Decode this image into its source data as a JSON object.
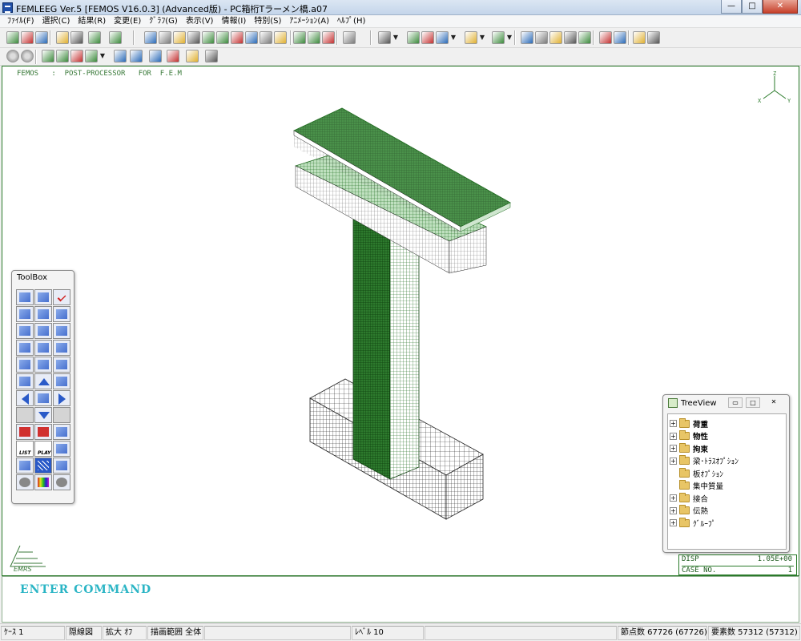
{
  "window": {
    "title": "FEMLEEG Ver.5 [FEMOS V16.0.3] (Advanced版) - PC箱桁Tラーメン橋.a07",
    "controls": {
      "minimize": "—",
      "maximize": "□",
      "close": "✕"
    }
  },
  "menubar": {
    "items": [
      {
        "label": "ﾌｧｲﾙ(F)"
      },
      {
        "label": "選択(C)"
      },
      {
        "label": "結果(R)"
      },
      {
        "label": "変更(E)"
      },
      {
        "label": "ｸﾞﾗﾌ(G)"
      },
      {
        "label": "表示(V)"
      },
      {
        "label": "情報(I)"
      },
      {
        "label": "特別(S)"
      },
      {
        "label": "ｱﾆﾒｰｼｮﾝ(A)"
      },
      {
        "label": "ﾍﾙﾌﾟ(H)"
      }
    ]
  },
  "toolbar1_icons": [
    "open-icon",
    "copy-icon",
    "mesh-icon",
    "layers-icon",
    "stack-icon",
    "print-icon",
    "export-icon",
    "contour-icon",
    "color-icon",
    "grid-green-icon",
    "grid-icon",
    "deform-icon",
    "vector-icon",
    "stress-icon",
    "node-icon",
    "circle-icon",
    "line-icon",
    "graph1-icon",
    "graph2-icon",
    "graph3-icon",
    "spring-icon",
    "view-icon",
    "rotate-icon",
    "pan-icon",
    "zoom-icon",
    "zoom2-icon",
    "red-mesh-icon",
    "red-node-icon",
    "grid-red-icon",
    "grid-dark-icon",
    "grid-black-icon",
    "section-icon",
    "down-arrow-icon",
    "up-arrow-icon"
  ],
  "toolbar2_icons": [
    "undo-icon",
    "redo-icon",
    "select-icon",
    "load-icon",
    "bc-icon",
    "material-icon",
    "sphere-icon",
    "cut-icon",
    "axis-icon",
    "label-icon",
    "ruler-icon",
    "legend-icon"
  ],
  "canvas": {
    "header": "FEMOS   :  POST-PROCESSOR   FOR  F.E.M",
    "axis": {
      "z": "Z",
      "x": "X",
      "y": "Y"
    }
  },
  "legend": {
    "row1_label": "DISP",
    "row1_value": "1.05E+00",
    "row2_label": "CASE NO.",
    "row2_value": "1"
  },
  "command": {
    "prompt": "ENTER COMMAND"
  },
  "status": {
    "case": "ｹｰｽ 1",
    "view": "隠線図",
    "zoom": "拡大 ｵﾌ",
    "range": "描画範囲 全体",
    "blank1": "",
    "level": "ﾚﾍﾞﾙ 10",
    "blank2": "",
    "nodes": "節点数 67726 (67726)",
    "elements": "要素数 57312 (57312)"
  },
  "toolbox": {
    "title": "ToolBox",
    "buttons": [
      "flip-view-icon",
      "multi-select-icon",
      "check-icon",
      "cube-front-icon",
      "cube-side-icon",
      "cube-top-icon",
      "cube-iso-icon",
      "cube-rotate-icon",
      "cube-yellow-icon",
      "axis-yx-icon",
      "axis-zx-icon",
      "axis-zy-icon",
      "rotate-x-icon",
      "rotate-z-icon",
      "rotate-y-icon",
      "perspective-icon",
      "arrow-up-icon",
      "plus-minus-icon",
      "arrow-left-icon",
      "axis-xyz-icon",
      "arrow-right-icon",
      "blank-icon",
      "arrow-down-icon",
      "blank2-icon",
      "move-red-icon",
      "pan-red-icon",
      "zoom-window-icon",
      "list-icon",
      "play-icon",
      "printer-icon",
      "label-node-icon",
      "hatch-icon",
      "pencil-icon",
      "undo-icon",
      "palette-icon",
      "redo-icon"
    ],
    "list_label": "LIST",
    "play_label": "PLAY"
  },
  "treeview": {
    "title": "TreeView",
    "items": [
      {
        "label": "荷重",
        "expandable": true,
        "bold": true
      },
      {
        "label": "物性",
        "expandable": true,
        "bold": true
      },
      {
        "label": "拘束",
        "expandable": true,
        "bold": true
      },
      {
        "label": "梁･ﾄﾗｽｵﾌﾟｼｮﾝ",
        "expandable": true,
        "bold": false
      },
      {
        "label": "板ｵﾌﾟｼｮﾝ",
        "expandable": false,
        "bold": false
      },
      {
        "label": "集中質量",
        "expandable": false,
        "bold": false
      },
      {
        "label": "接合",
        "expandable": true,
        "bold": false
      },
      {
        "label": "伝熱",
        "expandable": true,
        "bold": false
      },
      {
        "label": "ｸﾞﾙｰﾌﾟ",
        "expandable": true,
        "bold": false
      }
    ]
  },
  "colors": {
    "mesh_green": "#1e6b1e",
    "mesh_fill": "#5fae5f",
    "mesh_black": "#222222",
    "command_text": "#2bb5c5",
    "canvas_border": "#2a7a2a"
  }
}
